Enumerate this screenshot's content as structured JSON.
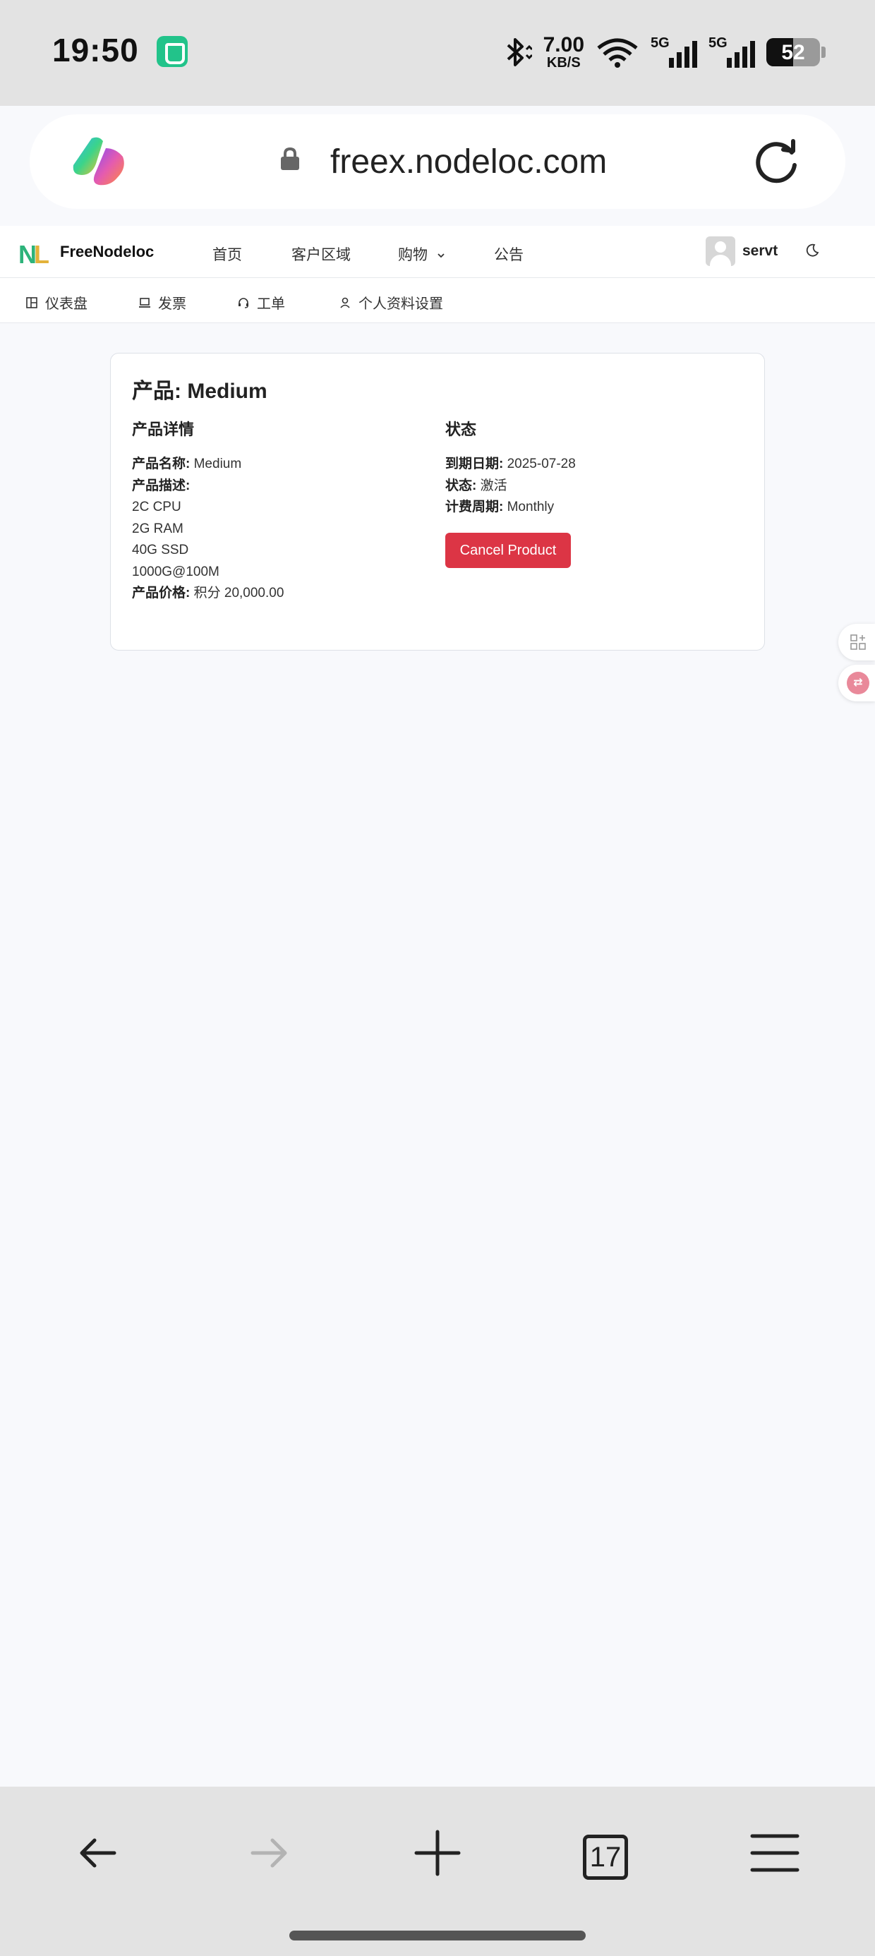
{
  "status_bar": {
    "time": "19:50",
    "net_speed": "7.00",
    "net_unit": "KB/S",
    "sim1": "5G",
    "sim2": "5G",
    "battery": "52"
  },
  "browser": {
    "url": "freex.nodeloc.com",
    "tab_count": "17"
  },
  "site": {
    "brand": "FreeNodeloc",
    "nav": [
      {
        "label": "首页"
      },
      {
        "label": "客户区域"
      },
      {
        "label": "购物"
      },
      {
        "label": "公告"
      }
    ],
    "user": "servt",
    "subnav": [
      {
        "label": "仪表盘"
      },
      {
        "label": "发票"
      },
      {
        "label": "工单"
      },
      {
        "label": "个人资料设置"
      }
    ]
  },
  "product": {
    "title": "产品: Medium",
    "details_heading": "产品详情",
    "name_label": "产品名称:",
    "name_value": "Medium",
    "desc_label": "产品描述:",
    "desc_lines": [
      "2C CPU",
      "2G RAM",
      "40G SSD",
      "1000G@100M"
    ],
    "price_label": "产品价格:",
    "price_value": "积分 20,000.00",
    "status_heading": "状态",
    "due_label": "到期日期:",
    "due_value": "2025-07-28",
    "status_label": "状态:",
    "status_value": "激活",
    "cycle_label": "计费周期:",
    "cycle_value": "Monthly",
    "cancel_label": "Cancel Product"
  },
  "colors": {
    "danger": "#dc3545",
    "page_bg": "#f8f9fc",
    "brand_green": "#2db37a"
  }
}
